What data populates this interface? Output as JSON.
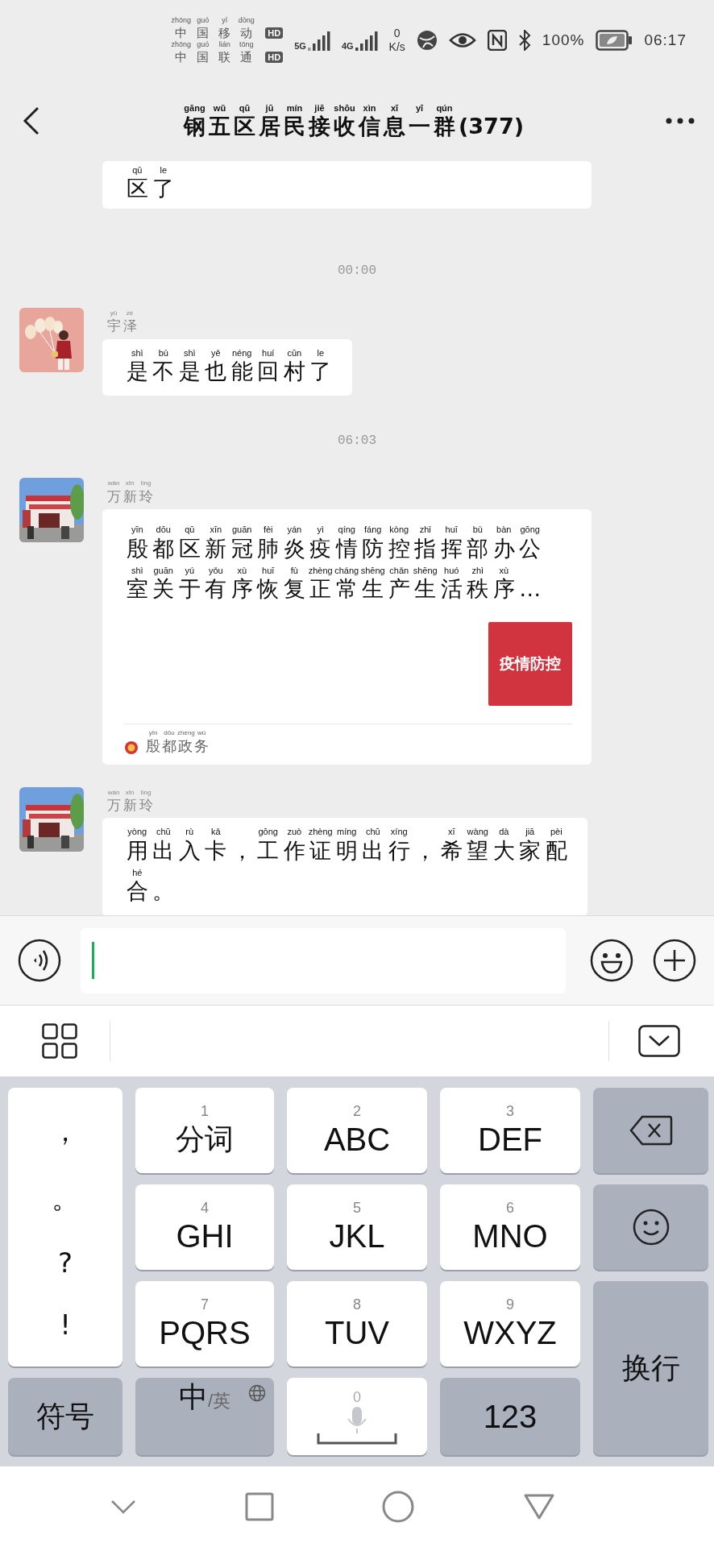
{
  "status_bar": {
    "carriers": [
      {
        "name": {
          "text": "中国移动",
          "pinyin": "zhōng guó yí dòng"
        },
        "badge": "HD"
      },
      {
        "name": {
          "text": "中国联通",
          "pinyin": "zhōng guó lián tōng"
        },
        "badge": "HD"
      }
    ],
    "networks": [
      "5G",
      "4G"
    ],
    "speed": {
      "value": "0",
      "unit": "K/s"
    },
    "battery": "100%",
    "time": "06:17"
  },
  "header": {
    "title": {
      "text": "钢五区居民接收信息一群",
      "pinyin": "gāng wǔ qū jū mín jiē shōu xìn xī yī qún"
    },
    "count": "(377)"
  },
  "messages": [
    {
      "kind": "text",
      "lines": [
        {
          "text": "区了",
          "pinyin": "qū le"
        }
      ]
    },
    {
      "kind": "time",
      "time": "00:00"
    },
    {
      "kind": "text",
      "avatar": {
        "kind": "picture"
      },
      "sender": {
        "text": "宇泽",
        "pinyin": "yǔ zé"
      },
      "lines": [
        {
          "text": "是不是也能回村了",
          "pinyin": "shì bù shì yě néng huí cūn le"
        }
      ]
    },
    {
      "kind": "time",
      "time": "06:03"
    },
    {
      "kind": "link",
      "avatar": {
        "kind": "picture"
      },
      "sender": {
        "text": "万新玲",
        "pinyin": "wàn xīn líng"
      },
      "lines": [
        {
          "text": "殷都区新冠肺炎疫情防控指挥部办公",
          "pinyin": "yīn dōu qū xīn guān fèi yán yì qíng fáng kòng zhǐ huī bù bàn gōng"
        },
        {
          "text": "室关于有序恢复正常生产生活秩序…",
          "pinyin": "shì guān yú yǒu xù huī fù zhèng cháng shēng chǎn shēng huó zhì xù"
        }
      ],
      "thumbnail": "疫情防控",
      "source": {
        "text": "殷都政务",
        "pinyin": "yīn dōu zhèng wù"
      }
    },
    {
      "kind": "text",
      "avatar": {
        "kind": "picture"
      },
      "sender": {
        "text": "万新玲",
        "pinyin": "wàn xīn líng"
      },
      "lines": [
        {
          "text": "用出入卡，工作证明出行，希望大家配",
          "pinyin": "yòng chū rù kǎ gōng zuò zhèng míng chū xíng xī wàng dà jiā pèi"
        },
        {
          "text": "合。",
          "pinyin": "hé"
        }
      ]
    }
  ],
  "input_bar": {
    "focused": true
  },
  "keyboard": {
    "punctuation": [
      "，",
      "。",
      "?",
      "!"
    ],
    "keys": [
      {
        "number": "1",
        "label": "分词"
      },
      {
        "number": "2",
        "label": "ABC"
      },
      {
        "number": "3",
        "label": "DEF"
      },
      {
        "number": "4",
        "label": "GHI"
      },
      {
        "number": "5",
        "label": "JKL"
      },
      {
        "number": "6",
        "label": "MNO"
      },
      {
        "number": "7",
        "label": "PQRS"
      },
      {
        "number": "8",
        "label": "TUV"
      },
      {
        "number": "9",
        "label": "WXYZ"
      }
    ],
    "enter": "换行",
    "symbols": "符号",
    "language": {
      "primary": "中",
      "secondary": "/英"
    },
    "space_number": "0",
    "numbers": "123"
  }
}
